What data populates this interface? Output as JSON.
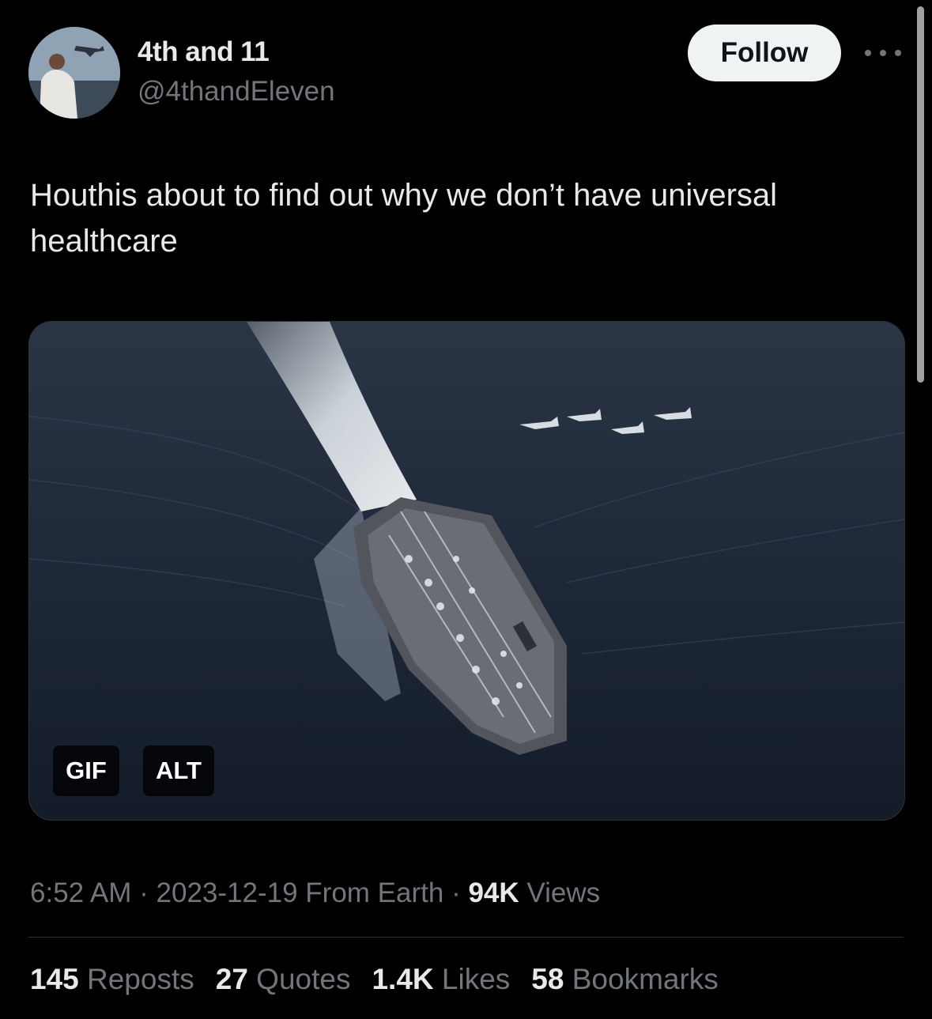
{
  "user": {
    "display_name": "4th and 11",
    "handle": "@4thandEleven"
  },
  "follow_label": "Follow",
  "tweet": {
    "text": "Houthis about to find out why we don’t have universal healthcare"
  },
  "media": {
    "badges": {
      "gif": "GIF",
      "alt": "ALT"
    }
  },
  "meta": {
    "time": "6:52 AM",
    "sep1": " · ",
    "date": "2023-12-19",
    "source": " From Earth",
    "sep2": " · ",
    "views_count": "94K",
    "views_label": " Views"
  },
  "stats": {
    "reposts": {
      "count": "145",
      "label": " Reposts"
    },
    "quotes": {
      "count": "27",
      "label": " Quotes"
    },
    "likes": {
      "count": "1.4K",
      "label": " Likes"
    },
    "bookmarks": {
      "count": "58",
      "label": " Bookmarks"
    }
  }
}
